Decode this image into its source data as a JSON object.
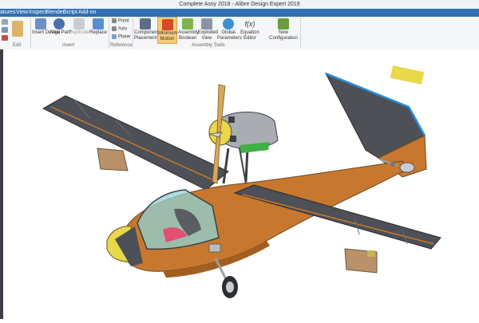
{
  "window": {
    "title": "Complete Assy 2018 - Alibre Design Expert 2019"
  },
  "menu": [
    "atures",
    "View",
    "Inspect",
    "Render",
    "Script",
    "Add-on"
  ],
  "ribbon": {
    "groups": {
      "edit": "Edit",
      "insert": "Insert",
      "reference": "Reference",
      "assembly_tools": "Assembly Tools"
    },
    "buttons": {
      "insert_design": "Insert Design",
      "new_part": "New Part*",
      "duplicate": "Duplicate",
      "replace": "Replace",
      "component_placement": "Component Placement",
      "minimum_motion": "Minimum Motion",
      "assembly_boolean": "Assembly Boolean",
      "exploded_view": "Exploded View",
      "global_parameters": "Global Parameters",
      "equation_editor": "Equation Editor",
      "new_configuration": "New Configuration"
    },
    "reference_items": [
      "Point",
      "Axis",
      "Plane"
    ],
    "equation_icon_text": "f(x)"
  },
  "colors": {
    "menubar": "#2f6fb2",
    "fuselage": "#c7782e",
    "wing": "#4d5157",
    "canopy": "#8fd3d6",
    "nose_cone": "#e8d84a",
    "highlight_edge": "#2a8fe0",
    "active_button": "#f7c97a"
  },
  "viewport": {
    "model": "seaplane-assembly",
    "icons": [
      "propeller",
      "engine-cowling",
      "canopy",
      "wing-float",
      "landing-gear-wheel",
      "tail-wheel"
    ]
  }
}
